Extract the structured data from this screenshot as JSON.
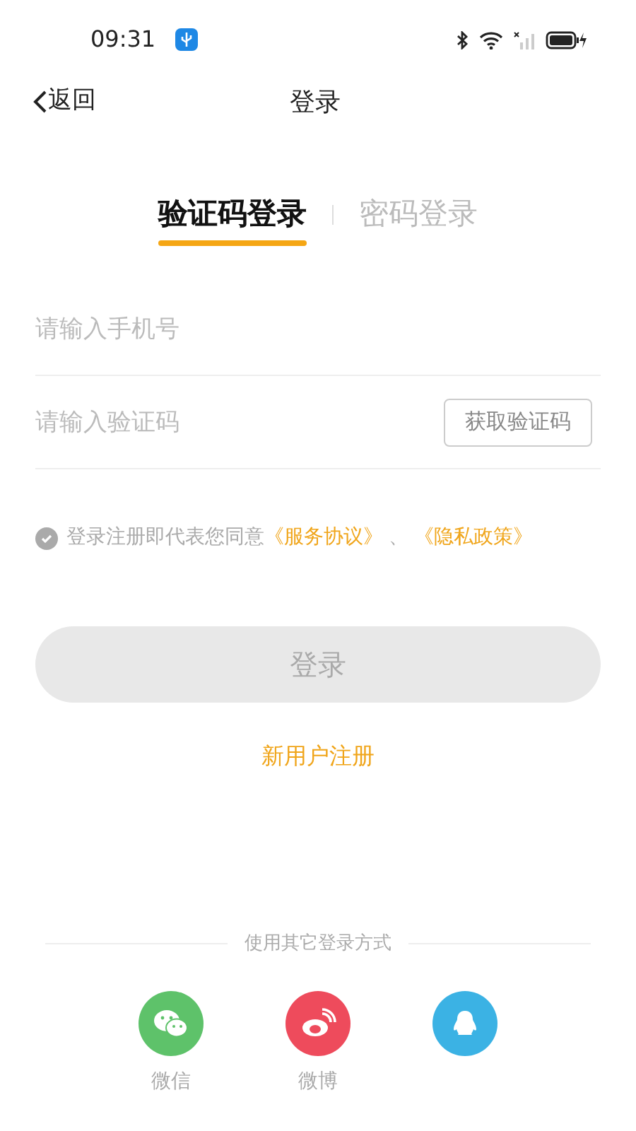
{
  "status_bar": {
    "time": "09:31"
  },
  "nav": {
    "back": "返回",
    "title": "登录"
  },
  "tabs": [
    {
      "label": "验证码登录",
      "selected": true
    },
    {
      "label": "密码登录",
      "selected": false
    }
  ],
  "fields": [
    {
      "placeholder": "请输入手机号"
    },
    {
      "placeholder": "请输入验证码",
      "button": "获取验证码"
    }
  ],
  "agreement": {
    "checked": true,
    "text": "登录注册即代表您同意",
    "links": [
      "《服务协议》",
      "《隐私政策》"
    ],
    "separator": "、"
  },
  "login_button": {
    "label": "登录",
    "disabled": true
  },
  "register_link": "新用户注册",
  "other_login": {
    "title": "使用其它登录方式",
    "options": [
      {
        "kind": "wechat",
        "label": "微信",
        "color": "#5ec26a"
      },
      {
        "kind": "weibo",
        "label": "微博",
        "color": "#ee4b5c"
      },
      {
        "kind": "qq",
        "color": "#3bb2e4"
      }
    ]
  }
}
